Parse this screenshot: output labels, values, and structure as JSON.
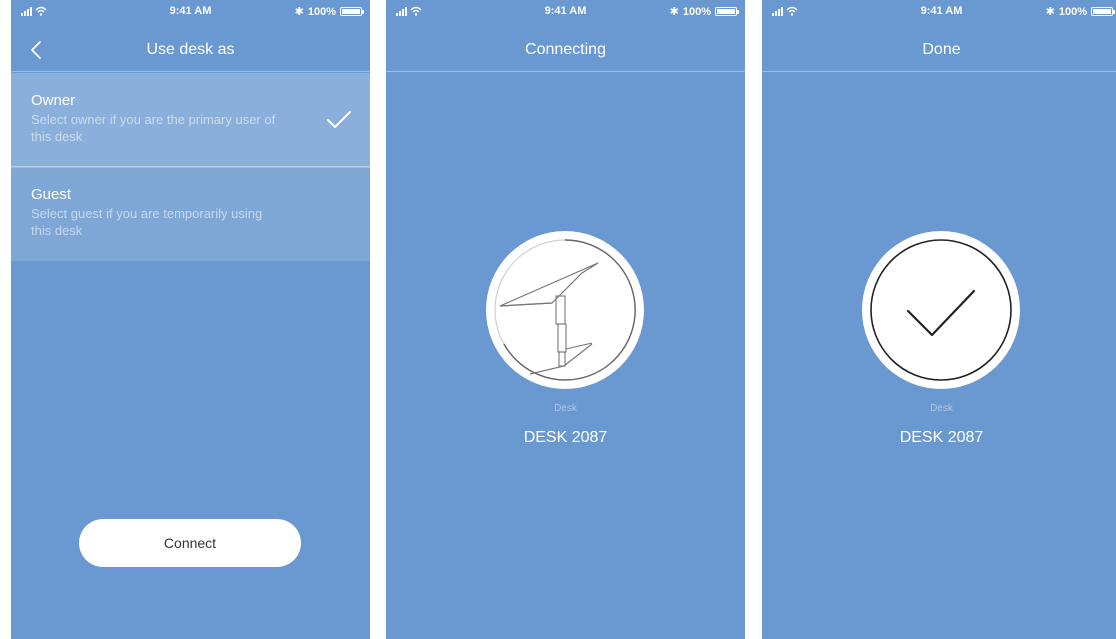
{
  "status": {
    "time": "9:41 AM",
    "battery": "100%"
  },
  "screen1": {
    "title": "Use desk as",
    "options": [
      {
        "title": "Owner",
        "description": "Select owner if you are the primary user of this desk",
        "selected": true
      },
      {
        "title": "Guest",
        "description": "Select guest if you are temporarily using this desk",
        "selected": false
      }
    ],
    "connect_label": "Connect"
  },
  "screen2": {
    "title": "Connecting",
    "desk_label": "Desk",
    "desk_name": "DESK 2087"
  },
  "screen3": {
    "title": "Done",
    "desk_label": "Desk",
    "desk_name": "DESK 2087"
  },
  "colors": {
    "background": "#6999d0",
    "button": "#ffffff",
    "text": "#ffffff"
  }
}
